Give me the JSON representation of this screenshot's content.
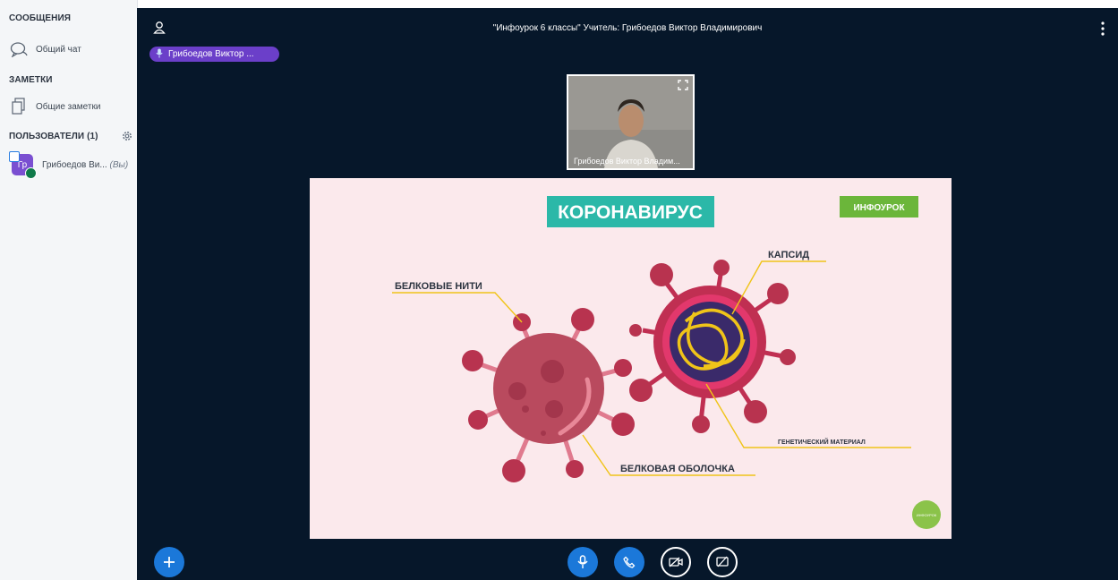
{
  "sidebar": {
    "messages_header": "СООБЩЕНИЯ",
    "public_chat": "Общий чат",
    "notes_header": "ЗАМЕТКИ",
    "shared_notes": "Общие заметки",
    "users_header": "ПОЛЬЗОВАТЕЛИ (1)",
    "user": {
      "initials": "Гр",
      "name": "Грибоедов Ви...",
      "you": "(Вы)"
    }
  },
  "main": {
    "title": "\"Инфоурок 6 классы\" Учитель: Грибоедов Виктор Владимирович",
    "talking_indicator": "Грибоедов Виктор ...",
    "webcam_label": "Грибоедов Виктор Владим..."
  },
  "slide": {
    "title": "КОРОНАВИРУС",
    "logo": "ИНФОУРОК",
    "label_protein_threads": "БЕЛКОВЫЕ НИТИ",
    "label_capsid": "КАПСИД",
    "label_genetic": "ГЕНЕТИЧЕСКИЙ МАТЕРИАЛ",
    "label_shell": "БЕЛКОВАЯ ОБОЛОЧКА",
    "badge": "ИНФОУРОК"
  },
  "colors": {
    "sidebar_bg": "#f4f6f8",
    "main_bg": "#06172a",
    "accent_blue": "#1b78d9",
    "talking_purple": "#6b3fc9",
    "slide_bg": "#fbe9ec",
    "slide_title_bg": "#2bb8a8",
    "virus_red": "#b8334f",
    "virus_gold": "#f0c419"
  },
  "icons": [
    "chat-icon",
    "notes-icon",
    "gear-icon",
    "user-list-icon",
    "mic-icon",
    "more-icon",
    "fullscreen-icon",
    "plus-icon",
    "phone-icon",
    "camera-off-icon",
    "screenshare-off-icon"
  ]
}
